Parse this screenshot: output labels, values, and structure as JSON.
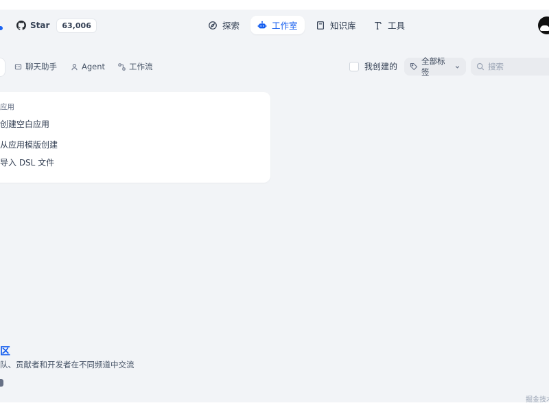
{
  "header": {
    "github": {
      "star_label": "Star",
      "star_count": "63,006"
    },
    "nav": [
      {
        "label": "探索",
        "icon": "compass-icon"
      },
      {
        "label": "工作室",
        "icon": "robot-icon",
        "active": true
      },
      {
        "label": "知识库",
        "icon": "book-icon"
      },
      {
        "label": "工具",
        "icon": "hammer-icon"
      }
    ]
  },
  "filters": {
    "tabs": [
      {
        "label": "聊天助手",
        "icon": "chat-bubble-icon"
      },
      {
        "label": "Agent",
        "icon": "agent-icon"
      },
      {
        "label": "工作流",
        "icon": "workflow-icon"
      }
    ],
    "created_by_me": "我创建的",
    "tags_select": "全部标签",
    "search_placeholder": "搜索"
  },
  "create_card": {
    "title": "应用",
    "options": [
      "创建空白应用",
      "从应用模版创建",
      "导入 DSL 文件"
    ]
  },
  "community": {
    "title": "区",
    "description": "队、贡献者和开发者在不同频道中交流"
  },
  "watermark": "掘金技术",
  "colors": {
    "accent": "#155eef",
    "background": "#f2f4f7"
  }
}
